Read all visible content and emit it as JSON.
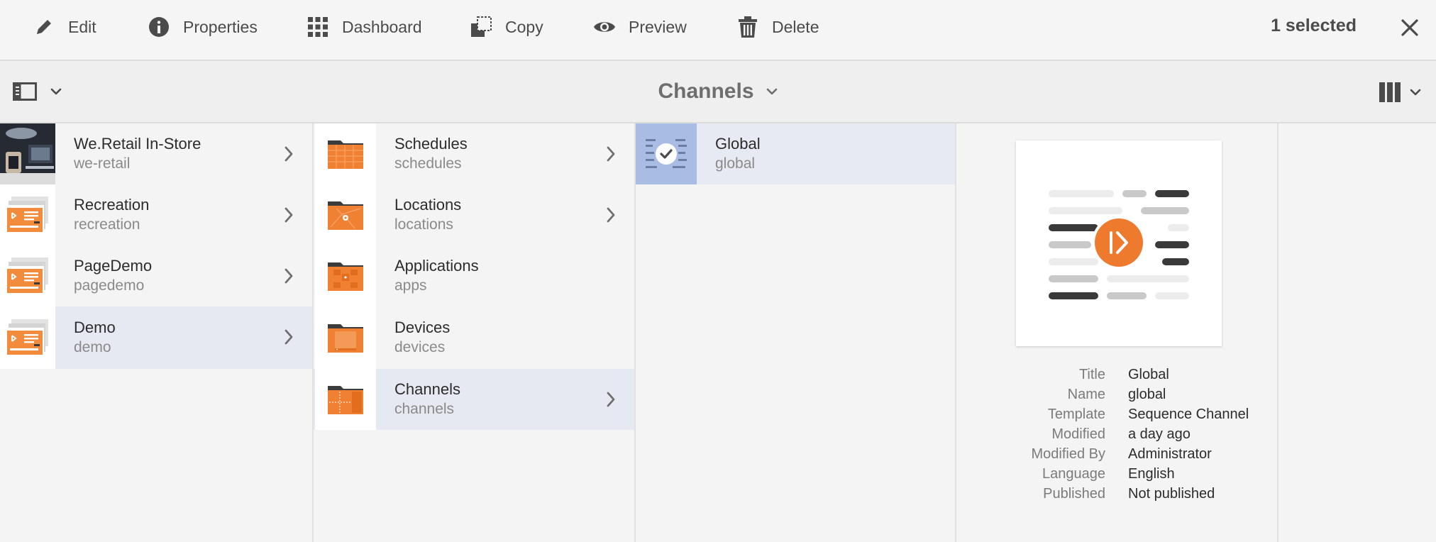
{
  "actionbar": {
    "actions": [
      {
        "label": "Edit",
        "icon": "pencil-icon"
      },
      {
        "label": "Properties",
        "icon": "info-icon"
      },
      {
        "label": "Dashboard",
        "icon": "grid-icon"
      },
      {
        "label": "Copy",
        "icon": "copy-icon"
      },
      {
        "label": "Preview",
        "icon": "eye-icon"
      },
      {
        "label": "Delete",
        "icon": "trash-icon"
      }
    ],
    "selection_count": "1 selected"
  },
  "header": {
    "title": "Channels"
  },
  "columns": {
    "sites": [
      {
        "title": "We.Retail In-Store",
        "name": "we-retail"
      },
      {
        "title": "Recreation",
        "name": "recreation"
      },
      {
        "title": "PageDemo",
        "name": "pagedemo"
      },
      {
        "title": "Demo",
        "name": "demo"
      }
    ],
    "folders": [
      {
        "title": "Schedules",
        "name": "schedules"
      },
      {
        "title": "Locations",
        "name": "locations"
      },
      {
        "title": "Applications",
        "name": "apps"
      },
      {
        "title": "Devices",
        "name": "devices"
      },
      {
        "title": "Channels",
        "name": "channels"
      }
    ],
    "channels": [
      {
        "title": "Global",
        "name": "global"
      }
    ]
  },
  "details": {
    "rows": [
      {
        "key": "Title",
        "value": "Global"
      },
      {
        "key": "Name",
        "value": "global"
      },
      {
        "key": "Template",
        "value": "Sequence Channel"
      },
      {
        "key": "Modified",
        "value": "a day ago"
      },
      {
        "key": "Modified By",
        "value": "Administrator"
      },
      {
        "key": "Language",
        "value": "English"
      },
      {
        "key": "Published",
        "value": "Not published"
      }
    ]
  },
  "colors": {
    "accent_orange": "#e8762c",
    "selected_row": "#e6e9f1",
    "checked_thumb": "#a9bde4"
  }
}
